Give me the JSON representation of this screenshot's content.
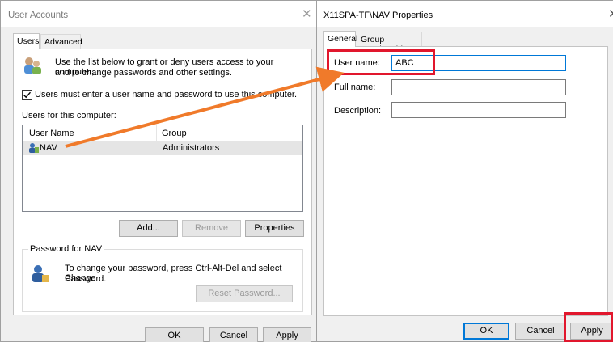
{
  "left_window": {
    "title": "User Accounts",
    "tabs": [
      "Users",
      "Advanced"
    ],
    "intro_text_line1": "Use the list below to grant or deny users access to your computer,",
    "intro_text_line2": "and to change passwords and other settings.",
    "checkbox_label": "Users must enter a user name and password to use this computer.",
    "checkbox_checked": true,
    "users_section_label": "Users for this computer:",
    "table": {
      "columns": [
        "User Name",
        "Group"
      ],
      "rows": [
        {
          "user_name": "NAV",
          "group": "Administrators"
        }
      ]
    },
    "buttons": {
      "add": "Add...",
      "remove": "Remove",
      "properties": "Properties"
    },
    "password_group": {
      "title": "Password for NAV",
      "text_line1": "To change your password, press Ctrl-Alt-Del and select Change",
      "text_line2": "Password.",
      "reset_button": "Reset Password..."
    },
    "footer_buttons": {
      "ok": "OK",
      "cancel": "Cancel",
      "apply": "Apply"
    }
  },
  "right_window": {
    "title": "X11SPA-TF\\NAV Properties",
    "tabs": [
      "General",
      "Group Membership"
    ],
    "fields": {
      "user_name_label": "User name:",
      "user_name_value": "ABC",
      "full_name_label": "Full name:",
      "full_name_value": "",
      "description_label": "Description:",
      "description_value": ""
    },
    "footer_buttons": {
      "ok": "OK",
      "cancel": "Cancel",
      "apply": "Apply"
    }
  },
  "annotation": {
    "highlight_color": "#e1172d",
    "arrow_color": "#f07a2a"
  }
}
